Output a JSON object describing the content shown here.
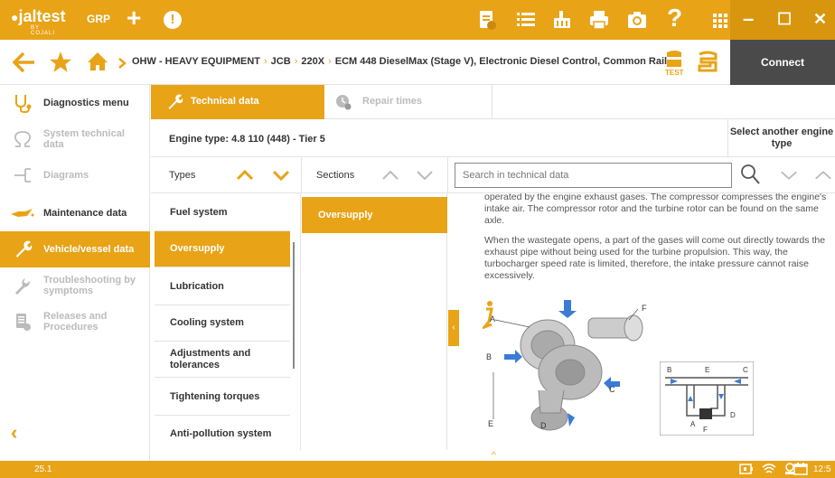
{
  "app": {
    "logo_text": "jaltest",
    "logo_sub": "BY COJALI",
    "group_label": "GRP",
    "accent": "#e8a317"
  },
  "toolbar": {
    "icons": [
      "add-icon",
      "alert-icon",
      "document-icon",
      "list-icon",
      "clean-icon",
      "print-icon",
      "camera-icon",
      "help-icon",
      "apps-grid-icon"
    ]
  },
  "window": {
    "minimize": "–",
    "maximize": "☐",
    "close": "✕"
  },
  "breadcrumb": {
    "items": [
      "OHW - HEAVY EQUIPMENT",
      "JCB",
      "220X",
      "ECM 448 DieselMax (Stage V), Electronic Diesel Control, Common Rail"
    ],
    "test_label": "TEST"
  },
  "connect_label": "Connect",
  "sidebar": {
    "items": [
      {
        "label": "Diagnostics menu",
        "icon": "stethoscope-icon",
        "state": "normal"
      },
      {
        "label": "System technical data",
        "icon": "omega-icon",
        "state": "disabled"
      },
      {
        "label": "Diagrams",
        "icon": "diagram-icon",
        "state": "disabled"
      },
      {
        "label": "Maintenance data",
        "icon": "oil-can-icon",
        "state": "normal"
      },
      {
        "label": "Vehicle/vessel data",
        "icon": "wrench-icon",
        "state": "active"
      },
      {
        "label": "Troubleshooting by symptoms",
        "icon": "troubleshoot-icon",
        "state": "disabled"
      },
      {
        "label": "Releases and Procedures",
        "icon": "releases-icon",
        "state": "disabled"
      }
    ]
  },
  "tabs": [
    {
      "label": "Technical data",
      "active": true
    },
    {
      "label": "Repair times",
      "active": false
    }
  ],
  "engine": {
    "label": "Engine type:",
    "value": "4.8 110 (448) - Tier 5",
    "select_another": "Select another engine type"
  },
  "columns": {
    "types_header": "Types",
    "sections_header": "Sections"
  },
  "search": {
    "placeholder": "Search in technical data"
  },
  "types": [
    "Fuel system",
    "Oversupply",
    "Lubrication",
    "Cooling system",
    "Adjustments and tolerances",
    "Tightening torques",
    "Anti-pollution system"
  ],
  "types_active_index": 1,
  "sections": [
    "Oversupply"
  ],
  "content": {
    "paragraphs": [
      "operated by the engine exhaust gases. The compressor compresses the engine's intake air. The compressor rotor and the turbine rotor can be found on the same axle.",
      "When the wastegate opens, a part of the gases will come out directly towards the exhaust pipe without being used for the turbine propulsion. This way, the turbocharger speed rate is limited, therefore, the intake pressure cannot raise excessively."
    ],
    "diagram_labels": [
      "A",
      "B",
      "C",
      "D",
      "E",
      "F"
    ]
  },
  "status": {
    "version": "25.1",
    "time": "12:5"
  }
}
